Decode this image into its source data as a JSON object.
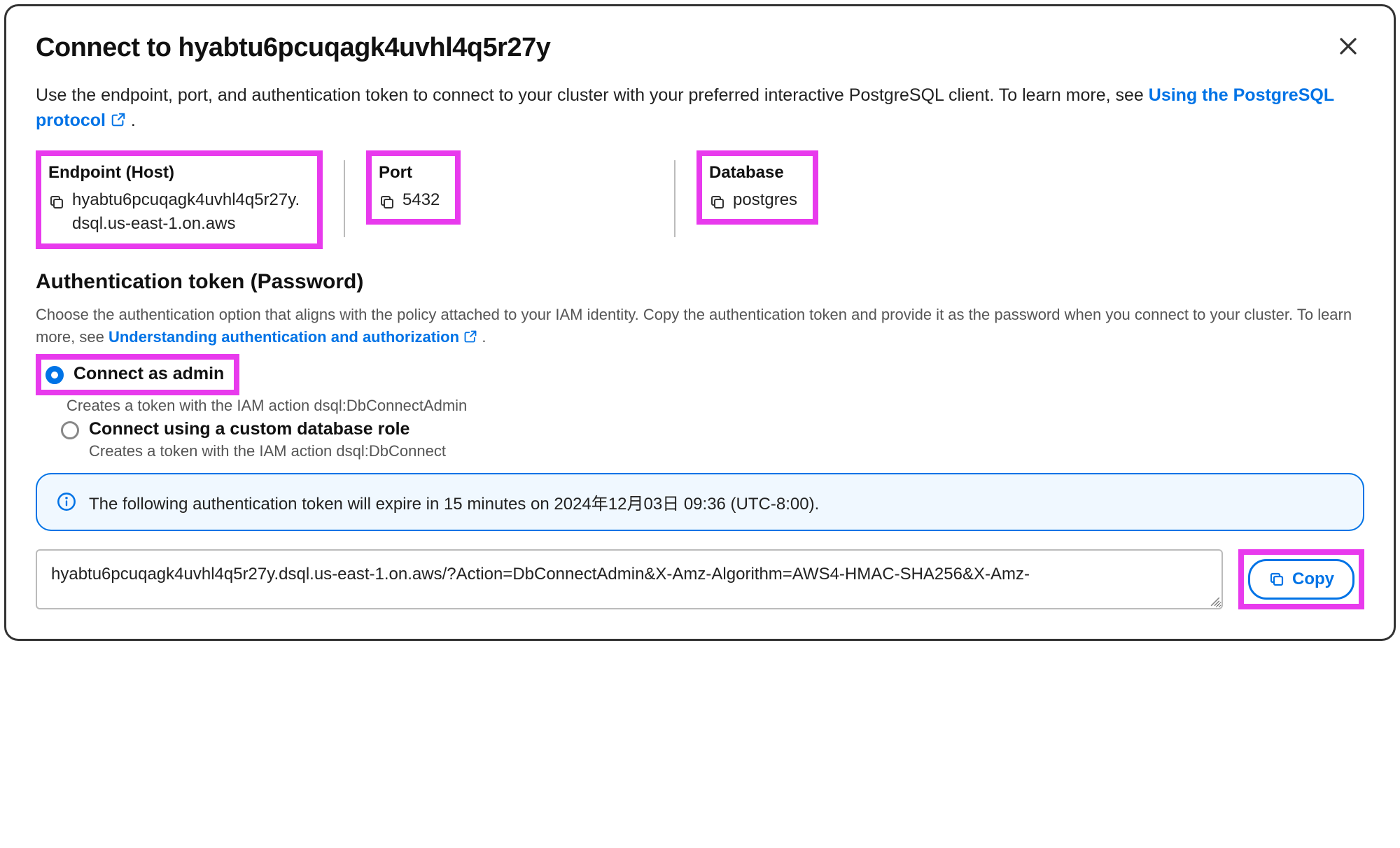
{
  "header": {
    "title": "Connect to hyabtu6pcuqagk4uvhl4q5r27y"
  },
  "intro": {
    "text_a": "Use the endpoint, port, and authentication token to connect to your cluster with your preferred interactive PostgreSQL client. To learn more, see ",
    "link": "Using the PostgreSQL protocol",
    "text_b": "."
  },
  "fields": {
    "endpoint": {
      "label": "Endpoint (Host)",
      "value": "hyabtu6pcuqagk4uvhl4q5r27y.dsql.us-east-1.on.aws"
    },
    "port": {
      "label": "Port",
      "value": "5432"
    },
    "database": {
      "label": "Database",
      "value": "postgres"
    }
  },
  "auth": {
    "title": "Authentication token (Password)",
    "desc_a": "Choose the authentication option that aligns with the policy attached to your IAM identity. Copy the authentication token and provide it as the password when you connect to your cluster. To learn more, see ",
    "desc_link": "Understanding authentication and authorization",
    "desc_b": ".",
    "options": [
      {
        "label": "Connect as admin",
        "sub": "Creates a token with the IAM action dsql:DbConnectAdmin",
        "selected": true
      },
      {
        "label": "Connect using a custom database role",
        "sub": "Creates a token with the IAM action dsql:DbConnect",
        "selected": false
      }
    ]
  },
  "banner": {
    "text": "The following authentication token will expire in 15 minutes on 2024年12月03日 09:36 (UTC-8:00)."
  },
  "token": {
    "value": "hyabtu6pcuqagk4uvhl4q5r27y.dsql.us-east-1.on.aws/?Action=DbConnectAdmin&X-Amz-Algorithm=AWS4-HMAC-SHA256&X-Amz-",
    "copy_label": "Copy"
  },
  "highlight_color": "#e83aed"
}
